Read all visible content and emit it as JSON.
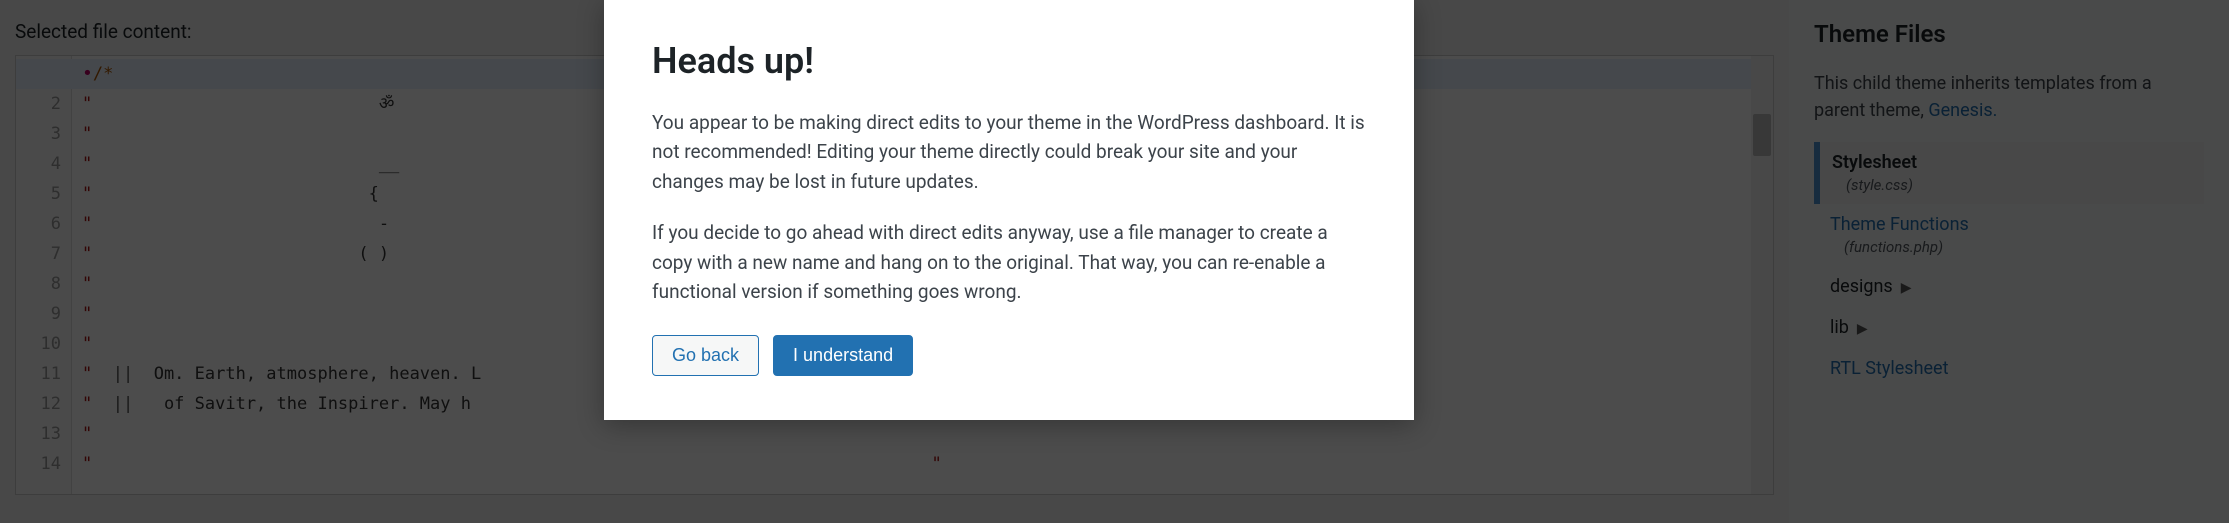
{
  "section_label": "Selected file content:",
  "code": {
    "lines": [
      "•/*",
      "\"                            ॐ",
      "\"",
      "\"                            __",
      "\"                           {",
      "\"                            -",
      "\"                          ( )",
      "\"",
      "\"",
      "\"",
      "\"  ||  Om. Earth, atmosphere, heaven. L",
      "\"  ||   of Savitr, the Inspirer. May h",
      "\"",
      "\"                                                                                  \""
    ],
    "line_count": 14
  },
  "sidebar": {
    "title": "Theme Files",
    "note_pre": "This child theme inherits templates from a parent theme, ",
    "note_link": "Genesis.",
    "files": [
      {
        "label": "Stylesheet",
        "sub": "(style.css)",
        "active": true,
        "folder": false
      },
      {
        "label": "Theme Functions",
        "sub": "(functions.php)",
        "active": false,
        "folder": false
      },
      {
        "label": "designs",
        "sub": "",
        "active": false,
        "folder": true
      },
      {
        "label": "lib",
        "sub": "",
        "active": false,
        "folder": true
      },
      {
        "label": "RTL Stylesheet",
        "sub": "",
        "active": false,
        "folder": false
      }
    ]
  },
  "modal": {
    "title": "Heads up!",
    "p1": "You appear to be making direct edits to your theme in the WordPress dashboard. It is not recommended! Editing your theme directly could break your site and your changes may be lost in future updates.",
    "p2": "If you decide to go ahead with direct edits anyway, use a file manager to create a copy with a new name and hang on to the original. That way, you can re-enable a functional version if something goes wrong.",
    "go_back": "Go back",
    "understand": "I understand"
  }
}
